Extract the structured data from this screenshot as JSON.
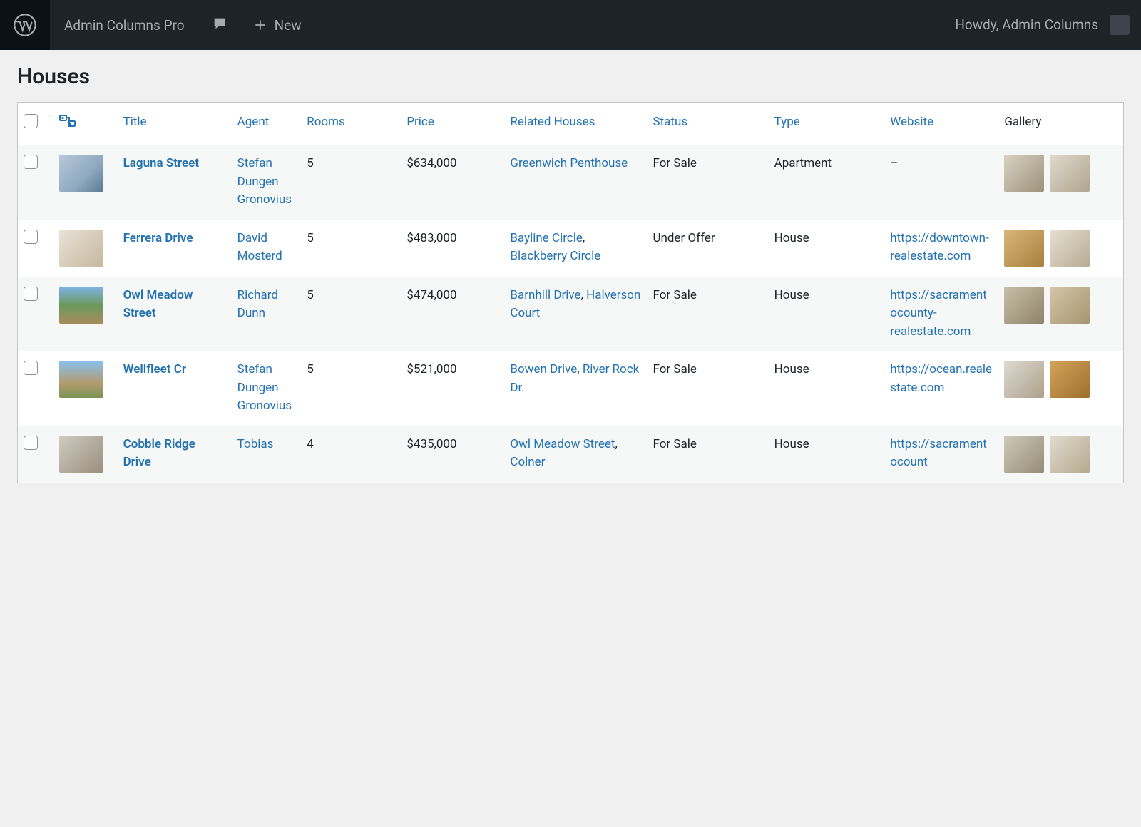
{
  "adminbar": {
    "site_name": "Admin Columns Pro",
    "new_label": "New",
    "howdy": "Howdy, Admin Columns"
  },
  "page": {
    "title": "Houses"
  },
  "columns": {
    "title": "Title",
    "agent": "Agent",
    "rooms": "Rooms",
    "price": "Price",
    "related": "Related Houses",
    "status": "Status",
    "type": "Type",
    "website": "Website",
    "gallery": "Gallery"
  },
  "rows": [
    {
      "title": "Laguna Street",
      "agent": "Stefan Dungen Gronovius",
      "rooms": "5",
      "price": "$634,000",
      "related": [
        {
          "text": "Greenwich Penthouse",
          "suffix": ""
        }
      ],
      "status": "For Sale",
      "type": "Apartment",
      "website_text": "–",
      "website_is_link": false
    },
    {
      "title": "Ferrera Drive",
      "agent": "David Mosterd",
      "rooms": "5",
      "price": "$483,000",
      "related": [
        {
          "text": "Bayline Circle",
          "suffix": ", "
        },
        {
          "text": "Blackberry Circle",
          "suffix": ""
        }
      ],
      "status": "Under Offer",
      "type": "House",
      "website_text": "https://downtown-realestate.com",
      "website_is_link": true
    },
    {
      "title": "Owl Meadow Street",
      "agent": "Richard Dunn",
      "rooms": "5",
      "price": "$474,000",
      "related": [
        {
          "text": "Barnhill Drive",
          "suffix": ", "
        },
        {
          "text": "Halverson Court",
          "suffix": ""
        }
      ],
      "status": "For Sale",
      "type": "House",
      "website_text": "https://sacramentocounty-realestate.com",
      "website_is_link": true
    },
    {
      "title": "Wellfleet Cr",
      "agent": "Stefan Dungen Gronovius",
      "rooms": "5",
      "price": "$521,000",
      "related": [
        {
          "text": "Bowen Drive",
          "suffix": ", "
        },
        {
          "text": "River Rock Dr.",
          "suffix": ""
        }
      ],
      "status": "For Sale",
      "type": "House",
      "website_text": "https://ocean.realestate.com",
      "website_is_link": true
    },
    {
      "title": "Cobble Ridge Drive",
      "agent": "Tobias",
      "rooms": "4",
      "price": "$435,000",
      "related": [
        {
          "text": "Owl Meadow Street",
          "suffix": ", "
        },
        {
          "text": "Colner",
          "suffix": ""
        }
      ],
      "status": "For Sale",
      "type": "House",
      "website_text": "https://sacramentocount",
      "website_is_link": true
    }
  ]
}
